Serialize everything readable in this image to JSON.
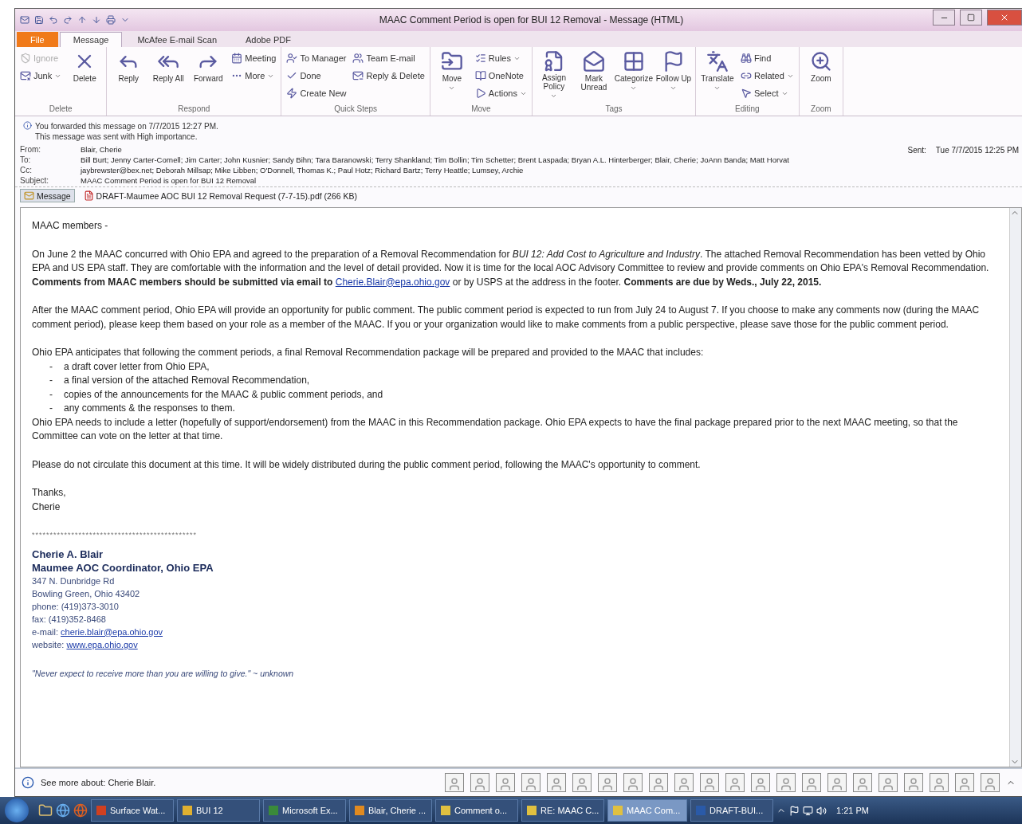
{
  "window": {
    "title": "MAAC Comment Period is open for BUI 12 Removal  -  Message (HTML)"
  },
  "ribbon_tabs": [
    {
      "label": "File",
      "kind": "file",
      "selected": false
    },
    {
      "label": "Message",
      "kind": "tab",
      "selected": true
    },
    {
      "label": "McAfee E-mail Scan",
      "kind": "tab",
      "selected": false
    },
    {
      "label": "Adobe PDF",
      "kind": "tab",
      "selected": false
    }
  ],
  "ribbon_groups": [
    {
      "label": "Delete",
      "items": [
        {
          "label": "Ignore",
          "kind": "small",
          "disabled": true,
          "dropdown": false
        },
        {
          "label": "Junk",
          "kind": "small",
          "disabled": false,
          "dropdown": true
        },
        {
          "label": "Delete",
          "kind": "large",
          "disabled": false,
          "dropdown": false
        }
      ]
    },
    {
      "label": "Respond",
      "items": [
        {
          "label": "Reply",
          "kind": "large",
          "disabled": false,
          "dropdown": false
        },
        {
          "label": "Reply All",
          "kind": "large",
          "disabled": false,
          "dropdown": false
        },
        {
          "label": "Forward",
          "kind": "large",
          "disabled": false,
          "dropdown": false
        },
        {
          "label": "Meeting",
          "kind": "small",
          "disabled": false,
          "dropdown": false
        },
        {
          "label": "More",
          "kind": "small",
          "disabled": false,
          "dropdown": true
        }
      ]
    },
    {
      "label": "Quick Steps",
      "items": [
        {
          "label": "To Manager",
          "kind": "small",
          "disabled": false,
          "dropdown": false
        },
        {
          "label": "Done",
          "kind": "small",
          "disabled": false,
          "dropdown": false
        },
        {
          "label": "Create New",
          "kind": "small",
          "disabled": false,
          "dropdown": false
        },
        {
          "label": "Team E-mail",
          "kind": "small",
          "disabled": false,
          "dropdown": false
        },
        {
          "label": "Reply & Delete",
          "kind": "small",
          "disabled": false,
          "dropdown": false
        }
      ]
    },
    {
      "label": "Move",
      "items": [
        {
          "label": "Move",
          "kind": "large",
          "disabled": false,
          "dropdown": true
        },
        {
          "label": "Rules",
          "kind": "small",
          "disabled": false,
          "dropdown": true
        },
        {
          "label": "OneNote",
          "kind": "small",
          "disabled": false,
          "dropdown": false
        },
        {
          "label": "Actions",
          "kind": "small",
          "disabled": false,
          "dropdown": true
        }
      ]
    },
    {
      "label": "Tags",
      "items": [
        {
          "label": "Assign Policy",
          "kind": "large",
          "disabled": false,
          "dropdown": true
        },
        {
          "label": "Mark Unread",
          "kind": "large",
          "disabled": false,
          "dropdown": false
        },
        {
          "label": "Categorize",
          "kind": "large",
          "disabled": false,
          "dropdown": true
        },
        {
          "label": "Follow Up",
          "kind": "large",
          "disabled": false,
          "dropdown": true
        }
      ]
    },
    {
      "label": "Editing",
      "items": [
        {
          "label": "Translate",
          "kind": "large",
          "disabled": false,
          "dropdown": true
        },
        {
          "label": "Find",
          "kind": "small",
          "disabled": false,
          "dropdown": false
        },
        {
          "label": "Related",
          "kind": "small",
          "disabled": false,
          "dropdown": true
        },
        {
          "label": "Select",
          "kind": "small",
          "disabled": false,
          "dropdown": true
        }
      ]
    },
    {
      "label": "Zoom",
      "items": [
        {
          "label": "Zoom",
          "kind": "large",
          "disabled": false,
          "dropdown": false
        }
      ]
    }
  ],
  "info_lines": [
    "You forwarded this message on 7/7/2015 12:27 PM.",
    "This message was sent with High importance."
  ],
  "header_fields": [
    {
      "label": "From:",
      "value": "Blair, Cherie"
    },
    {
      "label": "To:",
      "value": "Bill Burt; Jenny Carter-Cornell; Jim Carter; John Kusnier; Sandy Bihn; Tara Baranowski; Terry Shankland; Tim Bollin; Tim Schetter; Brent Laspada; Bryan A.L. Hinterberger; Blair, Cherie; JoAnn Banda; Matt Horvat"
    },
    {
      "label": "Cc:",
      "value": "jaybrewster@bex.net; Deborah Millsap; Mike Libben; O'Donnell, Thomas K.; Paul Hotz; Richard Bartz; Terry Heattle; Lumsey, Archie"
    },
    {
      "label": "Subject:",
      "value": "MAAC Comment Period is open for BUI 12 Removal"
    }
  ],
  "sent": {
    "label": "Sent:",
    "value": "Tue 7/7/2015 12:25 PM"
  },
  "attachments": [
    {
      "label": "Message",
      "kind": "message",
      "selected": true
    },
    {
      "label": "DRAFT-Maumee AOC BUI 12 Removal Request (7-7-15).pdf (266 KB)",
      "kind": "pdf",
      "selected": false
    }
  ],
  "body": {
    "greeting": "MAAC members -",
    "paragraphs": [
      {
        "before": "On June 2 the MAAC concurred with Ohio EPA and agreed to the preparation of a Removal Recommendation for *BUI 12: Add Cost to Agriculture and Industry*.  The attached Removal Recommendation has been vetted by Ohio EPA and US EPA staff.  They are comfortable with the information and the level of detail provided.  Now it is time for the local AOC Advisory Committee to review and provide comments on Ohio EPA's Removal Recommendation.  **Comments from MAAC members should be submitted via email to**",
        "link": "Cherie.Blair@epa.ohio.gov",
        "after": "or by USPS at the address in the footer.  **Comments are due by Weds., July 22, 2015.**"
      },
      {
        "before": "After the MAAC comment period, Ohio EPA will provide an opportunity for public comment.  The public comment period is expected to run from July 24 to August 7.  If you choose to make any comments now (during the MAAC comment period), please keep them based on your role as a member of the MAAC.  If you or your organization would like to make comments from a public perspective, please save those for the public comment period."
      },
      {
        "before": "Ohio EPA anticipates that following the comment periods, a final Removal Recommendation package will be prepared and provided to the MAAC that includes:"
      }
    ],
    "list": [
      {
        "bullet": "-",
        "text": "a draft cover letter from Ohio EPA,"
      },
      {
        "bullet": "-",
        "text": "a final version of the attached Removal Recommendation,"
      },
      {
        "bullet": "-",
        "text": "copies of the announcements for the MAAC & public comment periods, and"
      },
      {
        "bullet": "-",
        "text": "any comments & the responses to them."
      }
    ],
    "after_list": "Ohio EPA needs to include a letter (hopefully of support/endorsement) from the MAAC in this Recommendation package.  Ohio EPA expects to have the final package prepared prior to the next MAAC meeting, so that the Committee can vote on the letter at that time.",
    "closing_paragraph": "Please do not circulate this document at this time.  It will be widely distributed during the public comment period, following the MAAC's opportunity to comment.",
    "signoff": [
      "Thanks,",
      "Cherie"
    ],
    "separator": "**********************************************",
    "signature": {
      "name": "Cherie A. Blair",
      "role": "Maumee AOC Coordinator, Ohio EPA",
      "lines": [
        "347 N. Dunbridge Rd",
        "Bowling Green, Ohio 43402",
        "phone: (419)373-3010",
        "fax: (419)352-8468"
      ],
      "contacts": [
        {
          "label": "e-mail:",
          "link": "cherie.blair@epa.ohio.gov"
        },
        {
          "label": "website:",
          "link": "www.epa.ohio.gov"
        }
      ],
      "quote": "\"Never expect to receive more than you are willing to give.\" ~ unknown"
    }
  },
  "people_pane": {
    "text": "See more about: Cherie Blair."
  },
  "taskbar": {
    "items": [
      {
        "label": "Surface Wat...",
        "color": "#d04020",
        "selected": false
      },
      {
        "label": "BUI 12",
        "color": "#e0b030",
        "selected": false
      },
      {
        "label": "Microsoft Ex...",
        "color": "#3a8a3a",
        "selected": false
      },
      {
        "label": "Blair, Cherie ...",
        "color": "#e08a20",
        "selected": false
      },
      {
        "label": "Comment o...",
        "color": "#e0c040",
        "selected": false
      },
      {
        "label": "RE: MAAC C...",
        "color": "#e0c040",
        "selected": false
      },
      {
        "label": "MAAC Com...",
        "color": "#e0c040",
        "selected": true
      },
      {
        "label": "DRAFT-BUI...",
        "color": "#2a5aa8",
        "selected": false
      }
    ],
    "clock": "1:21 PM"
  }
}
